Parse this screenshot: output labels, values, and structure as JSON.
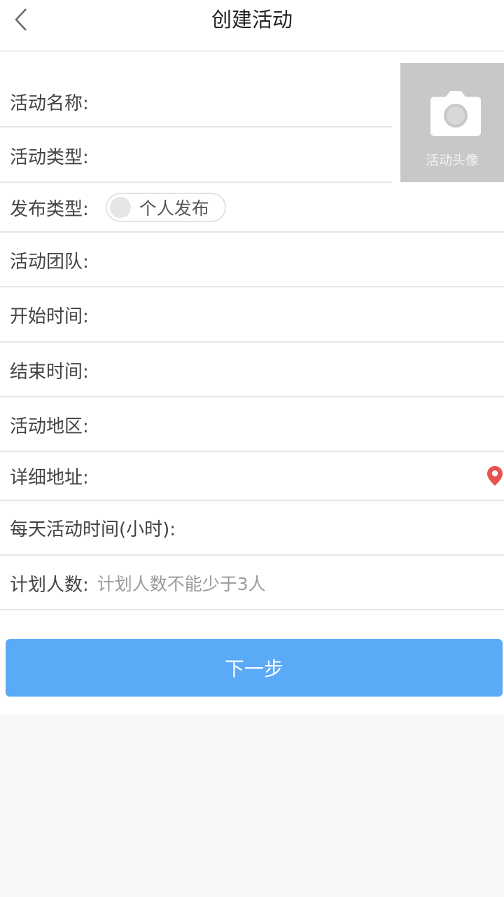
{
  "header": {
    "title": "创建活动",
    "back_icon": "chevron-left-icon"
  },
  "avatar": {
    "label": "活动头像",
    "icon": "camera-icon"
  },
  "fields": {
    "name": {
      "label": "活动名称:"
    },
    "type": {
      "label": "活动类型:"
    },
    "publish_type": {
      "label": "发布类型:",
      "toggle_label": "个人发布"
    },
    "team": {
      "label": "活动团队:"
    },
    "start_time": {
      "label": "开始时间:"
    },
    "end_time": {
      "label": "结束时间:"
    },
    "region": {
      "label": "活动地区:"
    },
    "address": {
      "label": "详细地址:",
      "icon": "location-pin-icon"
    },
    "daily_hours": {
      "label": "每天活动时间(小时):"
    },
    "planned_count": {
      "label": "计划人数:",
      "placeholder": "计划人数不能少于3人"
    }
  },
  "actions": {
    "next_label": "下一步"
  },
  "colors": {
    "primary_button": "#5aaaf7",
    "location_icon": "#e9534f",
    "avatar_bg": "#c8c8c8"
  }
}
